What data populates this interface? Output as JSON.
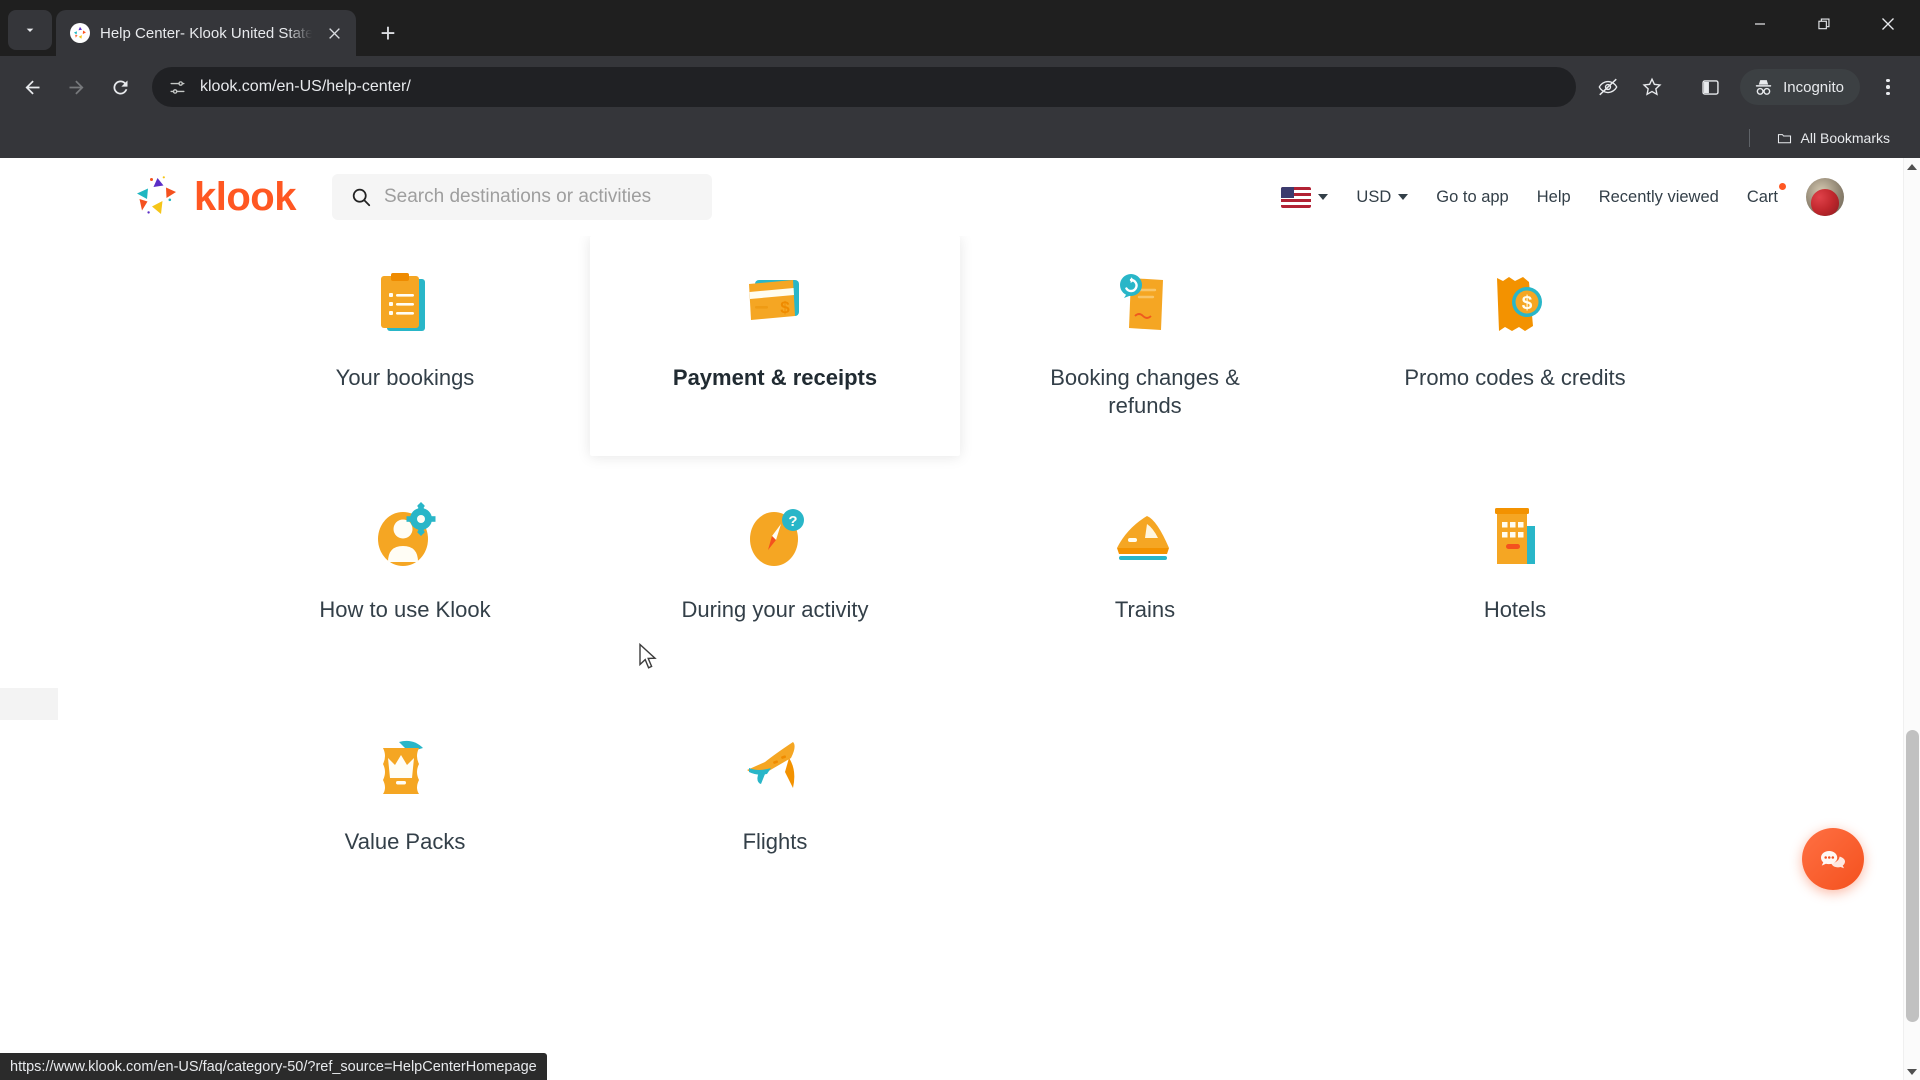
{
  "browser": {
    "tab": {
      "title": "Help Center- Klook United States",
      "favicon_icon": "klook-favicon",
      "close_icon": "close-icon"
    },
    "tab_search_icon": "chevron-down-icon",
    "new_tab_label": "+",
    "window_controls": {
      "minimize_icon": "minimize-icon",
      "maximize_icon": "restore-icon",
      "close_icon": "close-icon"
    },
    "toolbar": {
      "back_icon": "arrow-left-icon",
      "forward_icon": "arrow-right-icon",
      "reload_icon": "reload-icon",
      "site_info_icon": "tune-icon",
      "url": "klook.com/en-US/help-center/",
      "third_party_cookie_icon": "eye-slash-icon",
      "bookmark_icon": "star-icon",
      "side_panel_icon": "side-panel-icon",
      "incognito_label": "Incognito",
      "incognito_icon": "incognito-hat-icon",
      "menu_icon": "kebab-menu-icon"
    },
    "bookmarks_bar": {
      "all_bookmarks_label": "All Bookmarks",
      "folder_icon": "folder-icon"
    },
    "status_url": "https://www.klook.com/en-US/faq/category-50/?ref_source=HelpCenterHomepage"
  },
  "site": {
    "logo": {
      "wordmark": "klook",
      "mark_icon": "klook-petals-icon",
      "brand_color": "#ff5722"
    },
    "search": {
      "placeholder": "Search destinations or activities",
      "icon": "search-icon"
    },
    "nav": [
      {
        "label": "",
        "icon": "us-flag-icon",
        "caret": true,
        "name": "language-selector"
      },
      {
        "label": "USD",
        "icon": "",
        "caret": true,
        "name": "currency-selector"
      },
      {
        "label": "Go to app",
        "icon": "",
        "caret": false,
        "name": "go-to-app-link"
      },
      {
        "label": "Help",
        "icon": "",
        "caret": false,
        "name": "help-link"
      },
      {
        "label": "Recently viewed",
        "icon": "",
        "caret": false,
        "name": "recently-viewed-link"
      },
      {
        "label": "Cart",
        "icon": "",
        "caret": false,
        "name": "cart-link",
        "badge_dot": true
      }
    ],
    "avatar_name": "user-avatar"
  },
  "help_center": {
    "categories": [
      {
        "label": "Your bookings",
        "icon": "clipboard-list-icon",
        "hovered": false
      },
      {
        "label": "Payment & receipts",
        "icon": "credit-card-icon",
        "hovered": true
      },
      {
        "label": "Booking changes & refunds",
        "icon": "refund-note-icon",
        "hovered": false
      },
      {
        "label": "Promo codes & credits",
        "icon": "ticket-dollar-icon",
        "hovered": false
      },
      {
        "label": "How to use Klook",
        "icon": "user-gear-icon",
        "hovered": false
      },
      {
        "label": "During your activity",
        "icon": "compass-question-icon",
        "hovered": false
      },
      {
        "label": "Trains",
        "icon": "train-icon",
        "hovered": false
      },
      {
        "label": "Hotels",
        "icon": "hotel-building-icon",
        "hovered": false
      },
      {
        "label": "Value Packs",
        "icon": "crown-pack-icon",
        "hovered": false
      },
      {
        "label": "Flights",
        "icon": "airplane-icon",
        "hovered": false
      }
    ],
    "chat_fab_icon": "chat-bubbles-icon",
    "colors": {
      "icon_orange": "#f5a623",
      "icon_orange_dark": "#f39200",
      "icon_teal": "#29b6c8",
      "text": "#333f48",
      "accent": "#ff5722"
    }
  }
}
